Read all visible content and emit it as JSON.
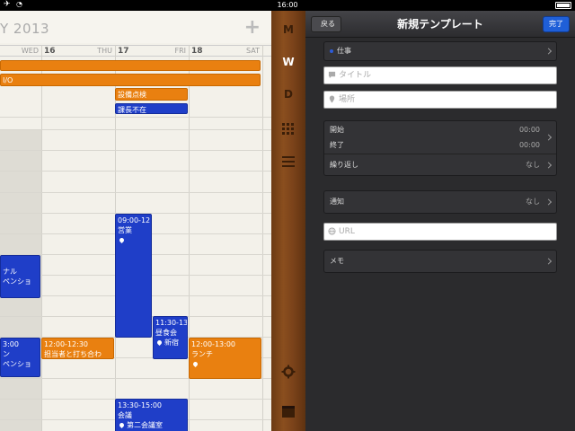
{
  "status_bar": {
    "time": "16:00"
  },
  "calendar": {
    "month_label": "Y 2013",
    "days": [
      {
        "num": "",
        "dow": "WED"
      },
      {
        "num": "16",
        "dow": "THU"
      },
      {
        "num": "17",
        "dow": "FRI"
      },
      {
        "num": "18",
        "dow": "SAT"
      }
    ],
    "events": {
      "io": "I/O",
      "equip": "設備点検",
      "away": "課長不在",
      "sales_time": "09:00-12",
      "sales_title": "営業",
      "left1_title": "ナル",
      "left1_sub": "ペンショ",
      "lunch_meet_time": "11:30-13",
      "lunch_meet_title": "昼食会",
      "lunch_meet_loc": "新宿",
      "left2_time": "3:00",
      "left2_title": "ン",
      "left2_sub": "ペンショ",
      "meeting_time": "12:00-12:30",
      "meeting_title": "担当者と打ち合わ",
      "lunch_time": "12:00-13:00",
      "lunch_title": "ランチ",
      "conf_time": "13:30-15:00",
      "conf_title": "会議",
      "conf_loc": "第二会議室"
    }
  },
  "sidebar": {
    "month": "M",
    "week": "W",
    "day": "D"
  },
  "panel": {
    "back_label": "戻る",
    "title": "新規テンプレート",
    "done_label": "完了",
    "calendar_label": "仕事",
    "title_placeholder": "タイトル",
    "location_placeholder": "場所",
    "start_label": "開始",
    "start_value": "00:00",
    "end_label": "終了",
    "end_value": "00:00",
    "repeat_label": "繰り返し",
    "repeat_value": "なし",
    "alert_label": "通知",
    "alert_value": "なし",
    "url_placeholder": "URL",
    "memo_label": "メモ"
  },
  "colors": {
    "event_orange": "#e98010",
    "event_blue": "#1f3ec8",
    "done_blue": "#1f5fd8"
  }
}
